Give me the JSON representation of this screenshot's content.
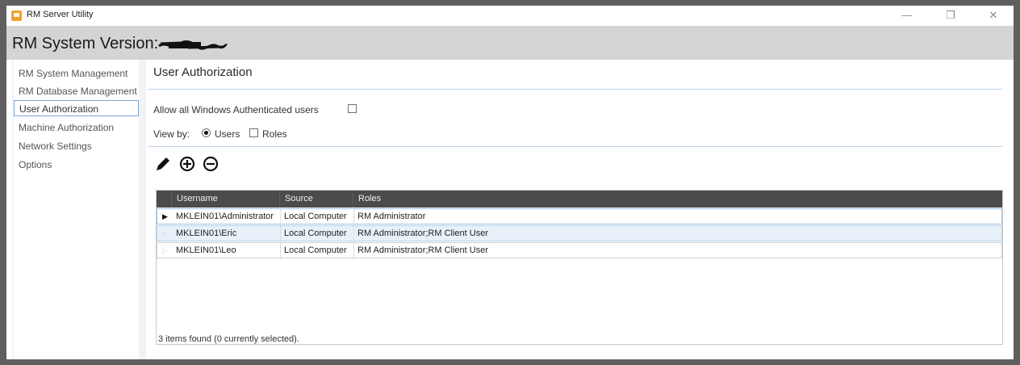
{
  "window": {
    "title": "RM Server Utility",
    "minimize_glyph": "—",
    "restore_glyph": "❐",
    "close_glyph": "✕"
  },
  "header": {
    "version_label": "RM System Version:",
    "version_value_note": "redacted"
  },
  "sidebar": {
    "items": [
      {
        "label": "RM System Management",
        "selected": false
      },
      {
        "label": "RM Database Management",
        "selected": false
      },
      {
        "label": "User Authorization",
        "selected": true
      },
      {
        "label": "Machine Authorization",
        "selected": false
      },
      {
        "label": "Network Settings",
        "selected": false
      },
      {
        "label": "Options",
        "selected": false
      }
    ]
  },
  "main": {
    "title": "User Authorization",
    "allow_all_label": "Allow all Windows Authenticated users",
    "allow_all_checked": false,
    "view_by_label": "View by:",
    "view_options": [
      {
        "label": "Users",
        "selected": true
      },
      {
        "label": "Roles",
        "selected": false
      }
    ],
    "toolbar": {
      "edit_icon": "pencil-icon",
      "add_icon": "add-circle-icon",
      "remove_icon": "remove-circle-icon"
    },
    "grid": {
      "columns": [
        "Username",
        "Source",
        "Roles"
      ],
      "rows": [
        {
          "username": "MKLEIN01\\Administrator",
          "source": "Local Computer",
          "roles": "RM Administrator",
          "current": true
        },
        {
          "username": "MKLEIN01\\Eric",
          "source": "Local Computer",
          "roles": "RM Administrator;RM Client User",
          "current": false
        },
        {
          "username": "MKLEIN01\\Leo",
          "source": "Local Computer",
          "roles": "RM Administrator;RM Client User",
          "current": false
        }
      ],
      "status": "3 items found (0 currently selected)."
    }
  },
  "colors": {
    "header_band": "#d4d4d4",
    "grid_header": "#4b4b4b",
    "selection_border": "#7aa7d6",
    "app_icon": "#f0a030"
  }
}
